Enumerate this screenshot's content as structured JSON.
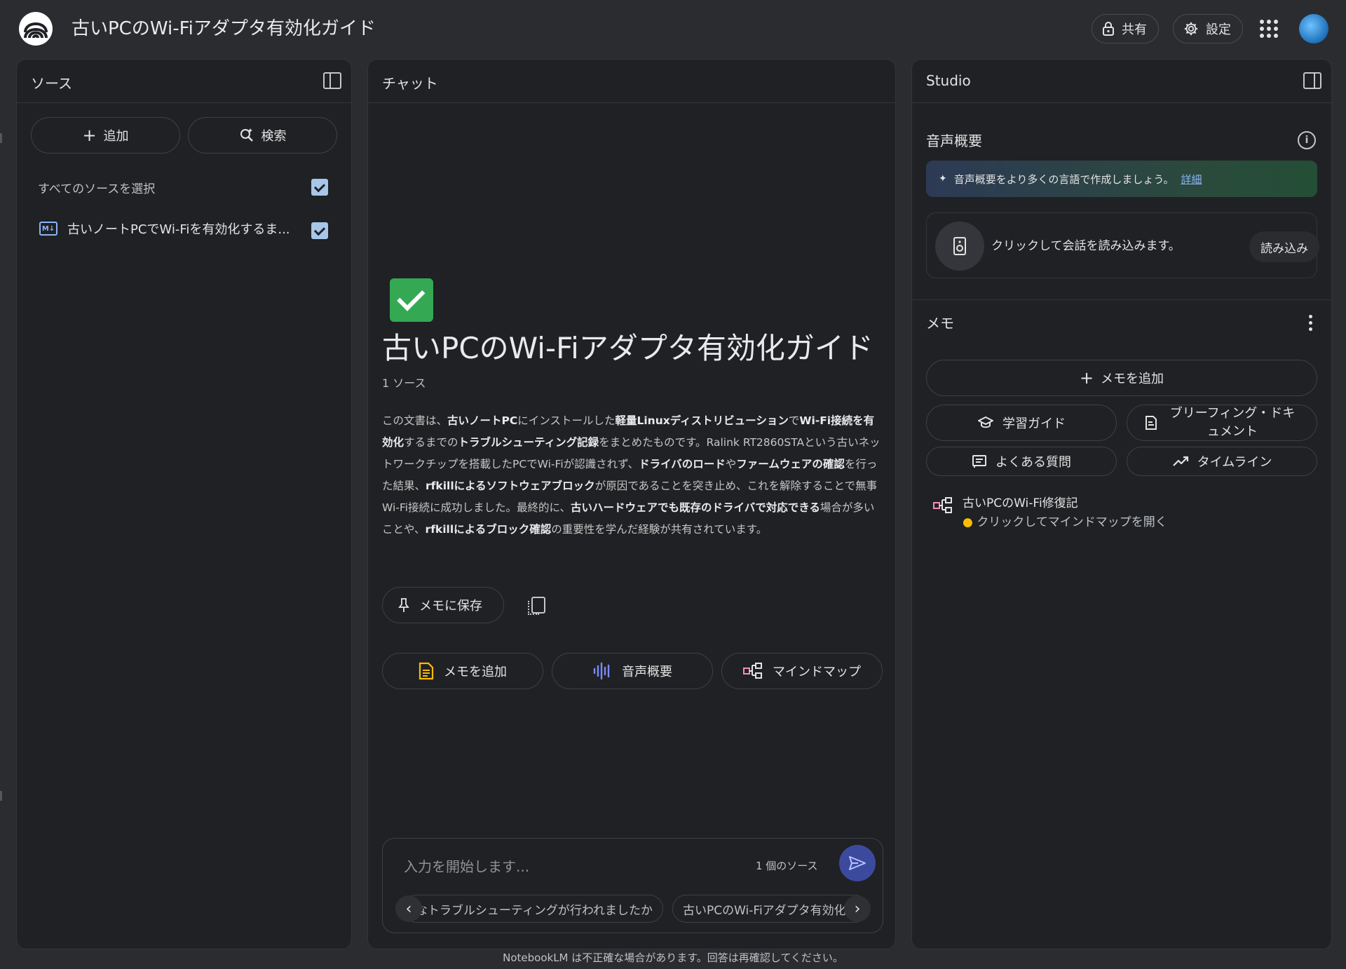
{
  "app": {
    "title": "古いPCのWi-Fiアダプタ有効化ガイド",
    "share_label": "共有",
    "settings_label": "設定"
  },
  "icons": {
    "logo": "notebooklm-logo",
    "share": "lock-icon",
    "settings": "gear-icon",
    "apps": "apps-grid-icon"
  },
  "sources": {
    "title": "ソース",
    "add_label": "追加",
    "search_label": "検索",
    "select_all_label": "すべてのソースを選択",
    "select_all_checked": true,
    "items": [
      {
        "label": "古いノートPCでWi-Fiを有効化するま...",
        "checked": true,
        "icon": "markdown-file-icon"
      }
    ]
  },
  "chat": {
    "title": "チャット",
    "notebook_emoji": "check-mark-button",
    "notebook_title": "古いPCのWi-Fiアダプタ有効化ガイド",
    "source_count": "1 ソース",
    "summary": [
      {
        "t": "この文書は、"
      },
      {
        "t": "古いノートPC",
        "b": true
      },
      {
        "t": "にインストールした"
      },
      {
        "t": "軽量Linuxディストリビューション",
        "b": true
      },
      {
        "t": "で"
      },
      {
        "t": "Wi-Fi接続を有効化",
        "b": true
      },
      {
        "t": "するまでの"
      },
      {
        "t": "トラブルシューティング記録",
        "b": true
      },
      {
        "t": "をまとめたものです。Ralink RT2860STAという古いネットワークチップを搭載したPCでWi-Fiが認識されず、"
      },
      {
        "t": "ドライバのロード",
        "b": true
      },
      {
        "t": "や"
      },
      {
        "t": "ファームウェアの確認",
        "b": true
      },
      {
        "t": "を行った結果、"
      },
      {
        "t": "rfkillによるソフトウェアブロック",
        "b": true
      },
      {
        "t": "が原因であることを突き止め、これを解除することで無事Wi-Fi接続に成功しました。最終的に、"
      },
      {
        "t": "古いハードウェアでも既存のドライバで対応できる",
        "b": true
      },
      {
        "t": "場合が多いことや、"
      },
      {
        "t": "rfkillによるブロック確認",
        "b": true
      },
      {
        "t": "の重要性を学んだ経験が共有されています。"
      }
    ],
    "save_memo_label": "メモに保存",
    "actions": {
      "add_memo": "メモを追加",
      "audio_overview": "音声概要",
      "mind_map": "マインドマップ"
    },
    "input_placeholder": "入力を開始します...",
    "input_source_count": "1 個のソース",
    "suggestions": [
      "どのようなトラブルシューティングが行われましたか",
      "古いPCのWi-Fiアダプタ有効化"
    ],
    "footer_note": "NotebookLM は不正確な場合があります。回答は再確認してください。"
  },
  "studio": {
    "title": "Studio",
    "audio_section_title": "音声概要",
    "promo_text": "音声概要をより多くの言語で作成しましょう。",
    "promo_link": "詳細",
    "audio_card_text": "クリックして会話を読み込みます。",
    "load_label": "読み込み",
    "memo_section_title": "メモ",
    "add_memo_label": "メモを追加",
    "buttons": {
      "study_guide": "学習ガイド",
      "briefing_doc": "ブリーフィング・ドキュメント",
      "faq": "よくある質問",
      "timeline": "タイムライン"
    },
    "mindmap_item": {
      "title": "古いPCのWi-Fi修復記",
      "subtitle": "クリックしてマインドマップを開く"
    }
  },
  "colors": {
    "background": "#2b2c30",
    "panel": "#202124",
    "accent_blue": "#8ab4f8",
    "send_button": "#3c4a9e",
    "checkbox": "#a8c7e8",
    "success_green": "#34a853"
  }
}
